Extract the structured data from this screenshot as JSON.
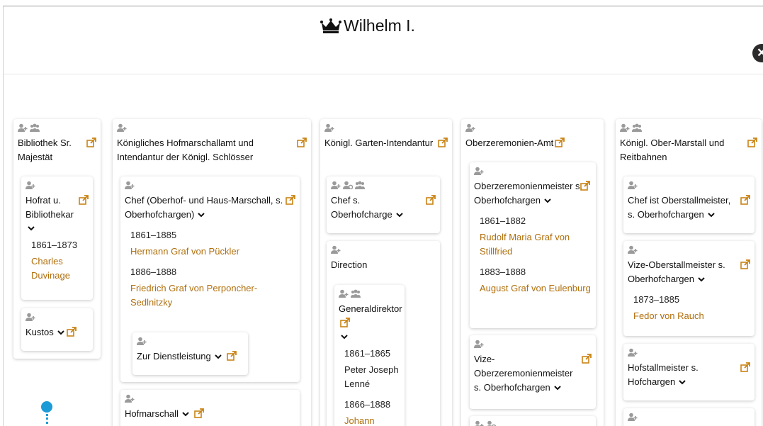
{
  "header": {
    "title": "Wilhelm I."
  },
  "columns": {
    "bib": {
      "title": "Bibliothek Sr. Majestät",
      "hofrat": {
        "title": "Hofrat u. Bibliothekar",
        "period": "1861–1873",
        "person": "Charles Duvinage"
      },
      "kustos": {
        "title": "Kustos"
      }
    },
    "hofmarschall": {
      "title": "Königliches Hofmarschallamt und Intendantur der Königl. Schlösser",
      "chef": {
        "title": "Chef (Oberhof- und Haus-Marschall, s. Oberhofchargen)",
        "period1": "1861–1885",
        "person1": "Hermann Graf von Pückler",
        "period2": "1886–1888",
        "person2": "Friedrich Graf von Perponcher-Sedlnitzky"
      },
      "dienst": {
        "title": "Zur Dienstleistung"
      },
      "hofmarschall": {
        "title": "Hofmarschall"
      }
    },
    "garten": {
      "title": "Königl. Garten-Intendantur",
      "chef": {
        "title": "Chef s. Oberhofcharge"
      },
      "direction": {
        "title": "Direction"
      },
      "gd": {
        "title": "Generaldirektor",
        "period1": "1861–1865",
        "person1": "Peter Joseph Lenné",
        "period2": "1866–1888",
        "person2": "Johann"
      }
    },
    "zeremonien": {
      "title": "Oberzeremonien-Amt",
      "ozm": {
        "title": "Oberzeremonienmeister s. Oberhofchargen",
        "period1": "1861–1882",
        "person1": "Rudolf Maria Graf von Stillfried",
        "period2": "1883–1888",
        "person2": "August Graf von Eulenburg"
      },
      "vize": {
        "title": "Vize-Oberzeremonienmeister s. Oberhofchargen"
      }
    },
    "marstall": {
      "title": "Königl. Ober-Marstall und Reitbahnen",
      "chef": {
        "title": "Chef ist Oberstallmeister, s. Oberhofchargen"
      },
      "vize": {
        "title": "Vize-Oberstallmeister s. Oberhofchargen",
        "period": "1873–1885",
        "person": "Fedor von Rauch"
      },
      "hofstall": {
        "title": "Hofstallmeister s. Hofchargen"
      }
    }
  },
  "colors": {
    "link": "#b06f0c",
    "accent": "#1d9bd7",
    "icon": "#9a9a9a"
  }
}
